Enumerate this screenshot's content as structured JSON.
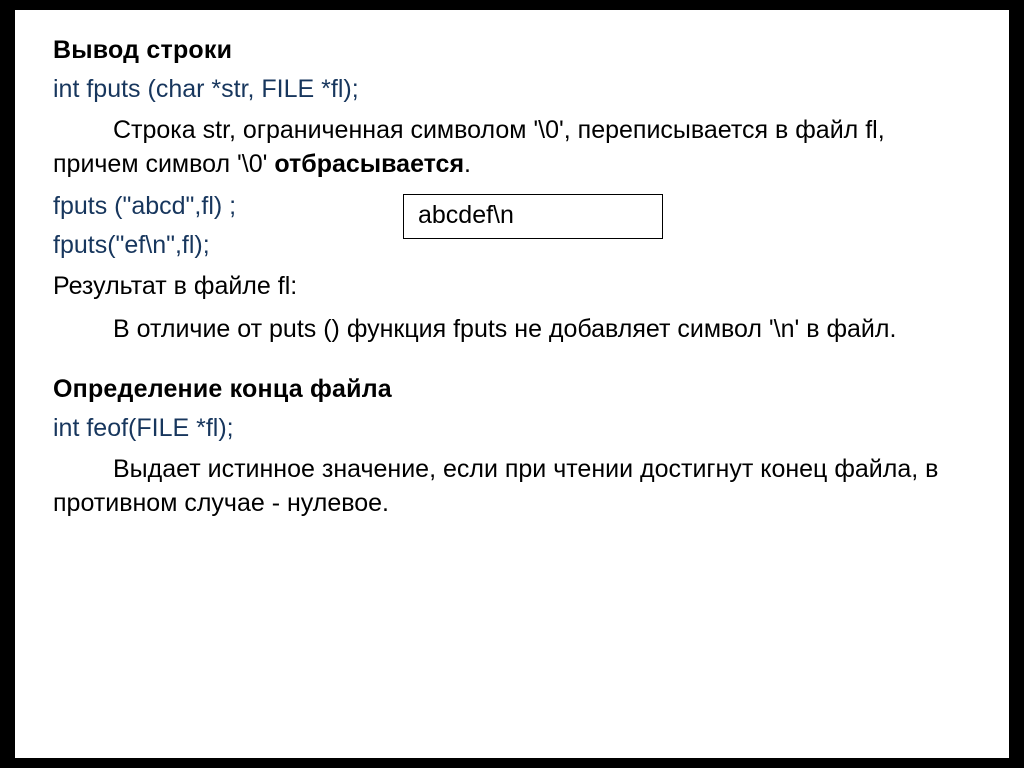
{
  "section1": {
    "heading": "Вывод строки",
    "sig": "int fputs (char *str, FILE *fl);",
    "desc_a": "Строка str, ограниченная символом '\\0', переписывается в файл fl, причем символ '\\0' ",
    "desc_b": "отбрасывается",
    "desc_c": ".",
    "code1": "fputs (\"abcd\",fl) ;",
    "code2": "fputs(\"ef\\n\",fl);",
    "box": "abcdef\\n",
    "result": "Результат  в файле fl:",
    "note": "В отличие от puts () функция  fputs не добавляет символ '\\n' в файл."
  },
  "section2": {
    "heading": "Определение конца файла",
    "sig": "int feof(FILE *fl);",
    "desc": "Выдает истинное значение, если при чтении достигнут конец файла, в противном случае - нулевое."
  }
}
